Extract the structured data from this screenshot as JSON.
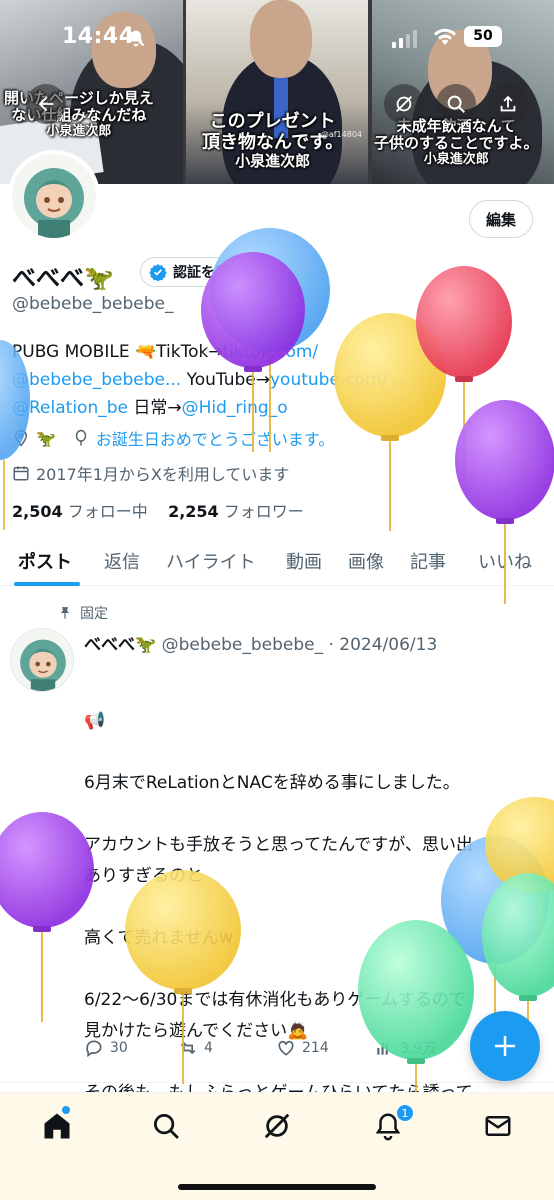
{
  "status_bar": {
    "time": "14:44",
    "battery": "50"
  },
  "banner": {
    "captions": [
      [
        "開いたページしか見え",
        "ない仕組みなんだね",
        "小泉進次郎"
      ],
      [
        "このプレゼント",
        "頂き物なんです。",
        "小泉進次郎"
      ],
      [
        "未成年飲酒なんて",
        "子供のすることですよ。",
        "小泉進次郎"
      ]
    ],
    "watermark": "@af14804"
  },
  "profile": {
    "edit_label": "編集",
    "name": "べべべ🦖",
    "verify_label": "認証を受ける",
    "handle": "@bebebe_bebebe_",
    "bio": {
      "line1_text": "PUBG MOBILE 🔫TikTok→",
      "line1_link": "tiktok.com/",
      "line2_link": "@bebebe_bebebe...",
      "line2_text": " YouTube→",
      "line2_link2": "youtube.com/",
      "line3_link": "@Relation_be",
      "line3_text": " 日常→",
      "line3_link2": "@Hid_ring_o"
    },
    "location": "🦖",
    "birthday": "お誕生日おめでとうございます。",
    "joined": "2017年1月からXを利用しています",
    "following_count": "2,504",
    "following_label": "フォロー中",
    "followers_count": "2,254",
    "followers_label": "フォロワー"
  },
  "tabs": [
    "ポスト",
    "返信",
    "ハイライト",
    "動画",
    "画像",
    "記事",
    "いいね"
  ],
  "post": {
    "pinned_label": "固定",
    "author": "べべべ🦖",
    "meta": "@bebebe_bebebe_ · 2024/06/13",
    "body": "📢\n\n6月末でReLationとNACを辞める事にしました。\n\nアカウントも手放そうと思ってたんですが、思い出\nありすぎるのと\n\n高くて売れませんw\n\n6/22〜6/30までは有休消化もありゲームするので\n見かけたら遊んでください🙇\n\nその後も、もしふらっとゲームひらいてたら誘って\nください😌✨",
    "replies": "30",
    "reposts": "4",
    "likes": "214",
    "views": "3.9万"
  },
  "nav": {
    "notification_badge": "1"
  },
  "colors": {
    "accent": "#1d9bf0",
    "text": "#0f1419",
    "muted": "#536471"
  }
}
